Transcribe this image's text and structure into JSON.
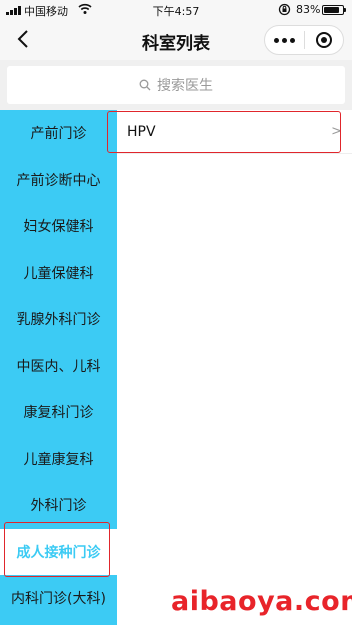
{
  "status_bar": {
    "carrier": "中国移动",
    "time": "下午4:57",
    "battery": "83%",
    "battery_level": 0.83,
    "icons": [
      "signal-icon",
      "wifi-icon",
      "orientation-lock-icon",
      "battery-icon"
    ]
  },
  "nav": {
    "title": "科室列表",
    "back_icon": "chevron-left-icon",
    "more_icon": "more-dots-icon",
    "close_icon": "record-circle-icon"
  },
  "search": {
    "placeholder": "搜索医生",
    "icon": "search-icon"
  },
  "sidebar": {
    "active_index": 9,
    "items": [
      {
        "label": "产前门诊"
      },
      {
        "label": "产前诊断中心"
      },
      {
        "label": "妇女保健科"
      },
      {
        "label": "儿童保健科"
      },
      {
        "label": "乳腺外科门诊"
      },
      {
        "label": "中医内、儿科"
      },
      {
        "label": "康复科门诊"
      },
      {
        "label": "儿童康复科"
      },
      {
        "label": "外科门诊"
      },
      {
        "label": "成人接种门诊"
      },
      {
        "label": "内科门诊(大科)"
      }
    ]
  },
  "content": {
    "items": [
      {
        "label": "HPV",
        "arrow": ">"
      }
    ]
  },
  "watermark": "aibaoya.com",
  "colors": {
    "accent": "#3ccbf4",
    "highlight": "#e0262c",
    "watermark": "#e8242a"
  }
}
